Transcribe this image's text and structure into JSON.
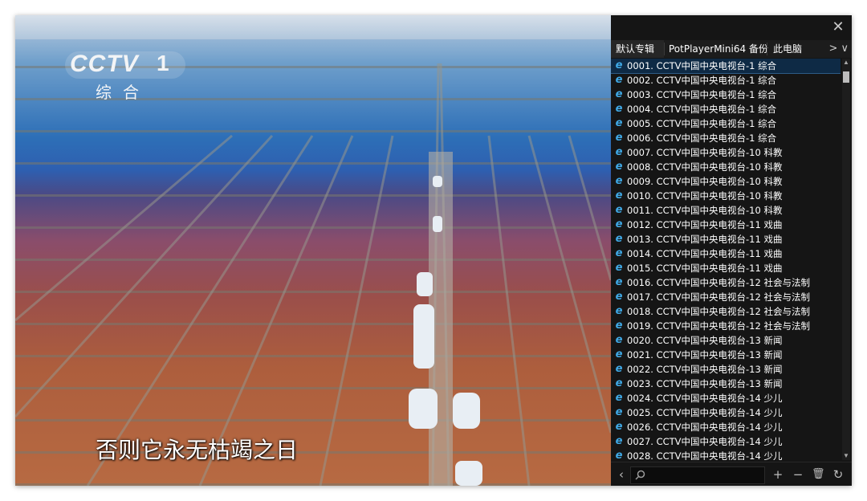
{
  "video": {
    "channel_logo": "CCTV",
    "channel_number": "1",
    "channel_name": "综合",
    "subtitle": "否则它永无枯竭之日"
  },
  "panel": {
    "close_icon": "close-icon",
    "tabs": [
      {
        "label": "默认专辑",
        "active": true
      },
      {
        "label": "PotPlayerMini64 备份",
        "active": false
      },
      {
        "label": "此电脑",
        "active": false
      }
    ],
    "tab_nav": ">  ∨",
    "playlist": [
      "0001. CCTV中国中央电视台-1 综合",
      "0002. CCTV中国中央电视台-1 综合",
      "0003. CCTV中国中央电视台-1 综合",
      "0004. CCTV中国中央电视台-1 综合",
      "0005. CCTV中国中央电视台-1 综合",
      "0006. CCTV中国中央电视台-1 综合",
      "0007. CCTV中国中央电视台-10 科教",
      "0008. CCTV中国中央电视台-10 科教",
      "0009. CCTV中国中央电视台-10 科教",
      "0010. CCTV中国中央电视台-10 科教",
      "0011. CCTV中国中央电视台-10 科教",
      "0012. CCTV中国中央电视台-11 戏曲",
      "0013. CCTV中国中央电视台-11 戏曲",
      "0014. CCTV中国中央电视台-11 戏曲",
      "0015. CCTV中国中央电视台-11 戏曲",
      "0016. CCTV中国中央电视台-12 社会与法制",
      "0017. CCTV中国中央电视台-12 社会与法制",
      "0018. CCTV中国中央电视台-12 社会与法制",
      "0019. CCTV中国中央电视台-12 社会与法制",
      "0020. CCTV中国中央电视台-13 新闻",
      "0021. CCTV中国中央电视台-13 新闻",
      "0022. CCTV中国中央电视台-13 新闻",
      "0023. CCTV中国中央电视台-13 新闻",
      "0024. CCTV中国中央电视台-14 少儿",
      "0025. CCTV中国中央电视台-14 少儿",
      "0026. CCTV中国中央电视台-14 少儿",
      "0027. CCTV中国中央电视台-14 少儿",
      "0028. CCTV中国中央电视台-14 少儿"
    ],
    "selected_index": 0,
    "search": {
      "value": "",
      "placeholder": ""
    },
    "colors": {
      "selected_row": "#0e2a45",
      "icon": "#3fa9e6",
      "panel_bg": "#151515"
    }
  }
}
